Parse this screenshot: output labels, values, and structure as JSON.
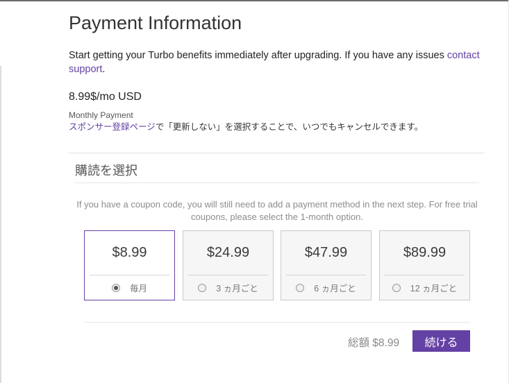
{
  "header": {
    "title": "Payment Information"
  },
  "intro": {
    "text": "Start getting your Turbo benefits immediately after upgrading. If you have any issues ",
    "link": "contact support",
    "suffix": "."
  },
  "pricing": {
    "price": "8.99$/mo USD",
    "monthly_label": "Monthly Payment",
    "cancel_link": "スポンサー登録ページ",
    "cancel_text": "で「更新しない」を選択することで、いつでもキャンセルできます。"
  },
  "subscription": {
    "title": "購読を選択",
    "coupon_note": "If you have a coupon code, you will still need to add a payment method in the next step. For free trial coupons, please select the 1-month option.",
    "plans": [
      {
        "amount": "$8.99",
        "label": "毎月",
        "selected": true
      },
      {
        "amount": "$24.99",
        "label": "3 ヵ月ごと",
        "selected": false
      },
      {
        "amount": "$47.99",
        "label": "6 ヵ月ごと",
        "selected": false
      },
      {
        "amount": "$89.99",
        "label": "12 ヵ月ごと",
        "selected": false
      }
    ]
  },
  "footer": {
    "total": "総額 $8.99",
    "continue_label": "続ける"
  },
  "colors": {
    "accent": "#6441a4"
  }
}
